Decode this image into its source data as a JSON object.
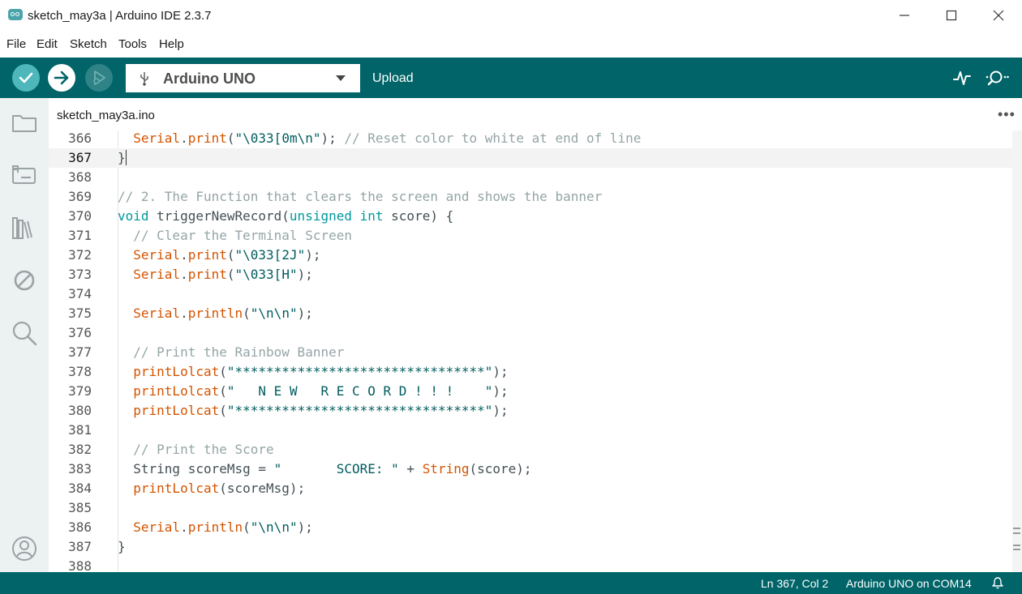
{
  "window": {
    "title": "sketch_may3a | Arduino IDE 2.3.7"
  },
  "menu": [
    "File",
    "Edit",
    "Sketch",
    "Tools",
    "Help"
  ],
  "toolbar": {
    "board": "Arduino UNO",
    "hover_label": "Upload",
    "icons": [
      "verify-icon",
      "upload-icon",
      "debug-icon",
      "usb-icon",
      "serial-plotter-icon",
      "serial-monitor-icon"
    ]
  },
  "sidebar": {
    "icons": [
      "sketchbook-folder-icon",
      "boards-manager-icon",
      "library-manager-icon",
      "debug-disabled-icon",
      "search-icon",
      "profile-icon"
    ]
  },
  "tabs": [
    {
      "label": "sketch_may3a.ino",
      "active": true
    }
  ],
  "editor": {
    "active_line": 367,
    "lines": [
      {
        "n": "366",
        "segs": [
          [
            "pl",
            "  "
          ],
          [
            "fn",
            "Serial"
          ],
          [
            "pl",
            "."
          ],
          [
            "fn",
            "print"
          ],
          [
            "pl",
            "("
          ],
          [
            "str",
            "\"\\033[0m\\n\""
          ],
          [
            "pl",
            "); "
          ],
          [
            "cm",
            "// Reset color to white at end of line"
          ]
        ]
      },
      {
        "n": "367",
        "segs": [
          [
            "pl",
            "}"
          ]
        ]
      },
      {
        "n": "368",
        "segs": []
      },
      {
        "n": "369",
        "segs": [
          [
            "cm",
            "// 2. The Function that clears the screen and shows the banner"
          ]
        ]
      },
      {
        "n": "370",
        "segs": [
          [
            "kw",
            "void"
          ],
          [
            "pl",
            " triggerNewRecord("
          ],
          [
            "kw",
            "unsigned"
          ],
          [
            "pl",
            " "
          ],
          [
            "kw",
            "int"
          ],
          [
            "pl",
            " score) {"
          ]
        ]
      },
      {
        "n": "371",
        "segs": [
          [
            "pl",
            "  "
          ],
          [
            "cm",
            "// Clear the Terminal Screen"
          ]
        ]
      },
      {
        "n": "372",
        "segs": [
          [
            "pl",
            "  "
          ],
          [
            "fn",
            "Serial"
          ],
          [
            "pl",
            "."
          ],
          [
            "fn",
            "print"
          ],
          [
            "pl",
            "("
          ],
          [
            "str",
            "\"\\033[2J\""
          ],
          [
            "pl",
            ");"
          ]
        ]
      },
      {
        "n": "373",
        "segs": [
          [
            "pl",
            "  "
          ],
          [
            "fn",
            "Serial"
          ],
          [
            "pl",
            "."
          ],
          [
            "fn",
            "print"
          ],
          [
            "pl",
            "("
          ],
          [
            "str",
            "\"\\033[H\""
          ],
          [
            "pl",
            ");"
          ]
        ]
      },
      {
        "n": "374",
        "segs": []
      },
      {
        "n": "375",
        "segs": [
          [
            "pl",
            "  "
          ],
          [
            "fn",
            "Serial"
          ],
          [
            "pl",
            "."
          ],
          [
            "fn",
            "println"
          ],
          [
            "pl",
            "("
          ],
          [
            "str",
            "\"\\n\\n\""
          ],
          [
            "pl",
            ");"
          ]
        ]
      },
      {
        "n": "376",
        "segs": []
      },
      {
        "n": "377",
        "segs": [
          [
            "pl",
            "  "
          ],
          [
            "cm",
            "// Print the Rainbow Banner"
          ]
        ]
      },
      {
        "n": "378",
        "segs": [
          [
            "pl",
            "  "
          ],
          [
            "fn",
            "printLolcat"
          ],
          [
            "pl",
            "("
          ],
          [
            "str",
            "\"********************************\""
          ],
          [
            "pl",
            ");"
          ]
        ]
      },
      {
        "n": "379",
        "segs": [
          [
            "pl",
            "  "
          ],
          [
            "fn",
            "printLolcat"
          ],
          [
            "pl",
            "("
          ],
          [
            "str",
            "\"   N E W   R E C O R D ! ! !    \""
          ],
          [
            "pl",
            ");"
          ]
        ]
      },
      {
        "n": "380",
        "segs": [
          [
            "pl",
            "  "
          ],
          [
            "fn",
            "printLolcat"
          ],
          [
            "pl",
            "("
          ],
          [
            "str",
            "\"********************************\""
          ],
          [
            "pl",
            ");"
          ]
        ]
      },
      {
        "n": "381",
        "segs": []
      },
      {
        "n": "382",
        "segs": [
          [
            "pl",
            "  "
          ],
          [
            "cm",
            "// Print the Score"
          ]
        ]
      },
      {
        "n": "383",
        "segs": [
          [
            "pl",
            "  String scoreMsg = "
          ],
          [
            "str",
            "\"       SCORE: \""
          ],
          [
            "pl",
            " + "
          ],
          [
            "fn",
            "String"
          ],
          [
            "pl",
            "(score);"
          ]
        ]
      },
      {
        "n": "384",
        "segs": [
          [
            "pl",
            "  "
          ],
          [
            "fn",
            "printLolcat"
          ],
          [
            "pl",
            "(scoreMsg);"
          ]
        ]
      },
      {
        "n": "385",
        "segs": []
      },
      {
        "n": "386",
        "segs": [
          [
            "pl",
            "  "
          ],
          [
            "fn",
            "Serial"
          ],
          [
            "pl",
            "."
          ],
          [
            "fn",
            "println"
          ],
          [
            "pl",
            "("
          ],
          [
            "str",
            "\"\\n\\n\""
          ],
          [
            "pl",
            ");"
          ]
        ]
      },
      {
        "n": "387",
        "segs": [
          [
            "pl",
            "}"
          ]
        ]
      },
      {
        "n": "388",
        "segs": []
      }
    ]
  },
  "status": {
    "position": "Ln 367, Col 2",
    "board": "Arduino UNO on COM14"
  },
  "colors": {
    "toolbar_bg": "#006468",
    "accent": "#4db7bb",
    "keyword": "#00979c",
    "function": "#d35400",
    "string": "#005c5f",
    "comment": "#95a5a6"
  }
}
